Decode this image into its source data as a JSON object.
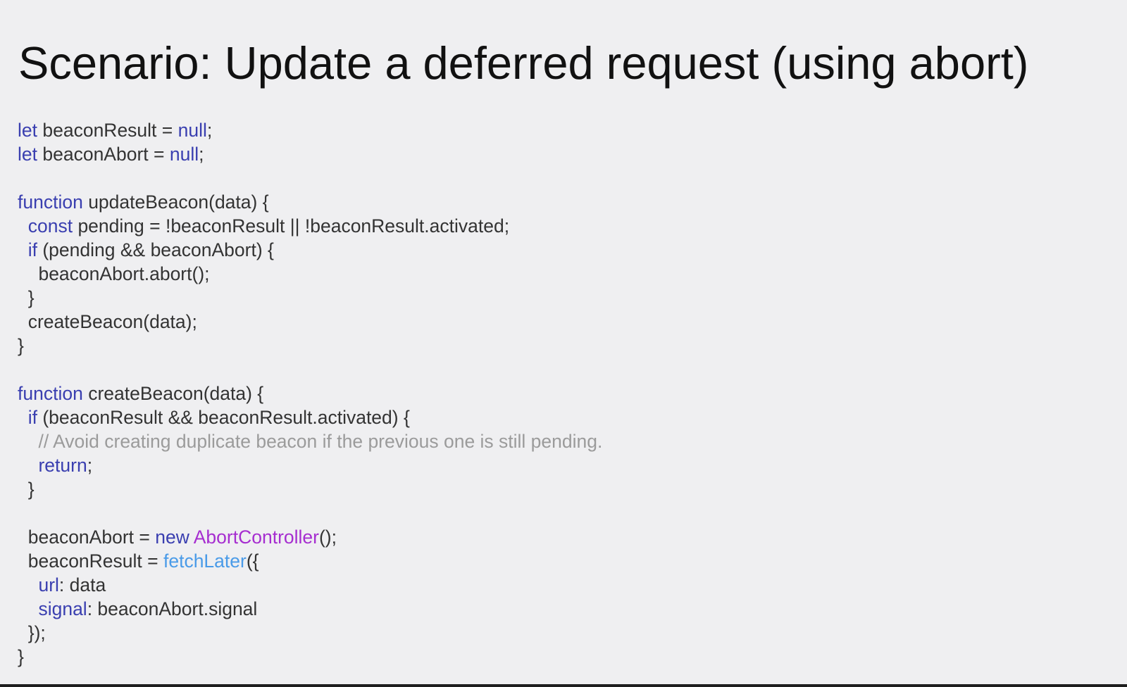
{
  "slide": {
    "title": "Scenario: Update a deferred request (using abort)"
  },
  "colors": {
    "background": "#efeff1",
    "text": "#333333",
    "keyword": "#3a3fb0",
    "class": "#a62ed0",
    "function_call": "#4a9be8",
    "comment": "#9b9b9b"
  },
  "code": {
    "lines": [
      [
        {
          "t": "let",
          "k": "keyword"
        },
        {
          "t": " beaconResult = ",
          "k": "plain"
        },
        {
          "t": "null",
          "k": "keyword"
        },
        {
          "t": ";",
          "k": "plain"
        }
      ],
      [
        {
          "t": "let",
          "k": "keyword"
        },
        {
          "t": " beaconAbort = ",
          "k": "plain"
        },
        {
          "t": "null",
          "k": "keyword"
        },
        {
          "t": ";",
          "k": "plain"
        }
      ],
      [],
      [
        {
          "t": "function",
          "k": "keyword"
        },
        {
          "t": " updateBeacon(data) {",
          "k": "plain"
        }
      ],
      [
        {
          "t": "  ",
          "k": "plain"
        },
        {
          "t": "const",
          "k": "keyword"
        },
        {
          "t": " pending = !beaconResult || !beaconResult.activated;",
          "k": "plain"
        }
      ],
      [
        {
          "t": "  ",
          "k": "plain"
        },
        {
          "t": "if",
          "k": "keyword"
        },
        {
          "t": " (pending && beaconAbort) {",
          "k": "plain"
        }
      ],
      [
        {
          "t": "    beaconAbort.abort();",
          "k": "plain"
        }
      ],
      [
        {
          "t": "  }",
          "k": "plain"
        }
      ],
      [
        {
          "t": "  createBeacon(data);",
          "k": "plain"
        }
      ],
      [
        {
          "t": "}",
          "k": "plain"
        }
      ],
      [],
      [
        {
          "t": "function",
          "k": "keyword"
        },
        {
          "t": " createBeacon(data) {",
          "k": "plain"
        }
      ],
      [
        {
          "t": "  ",
          "k": "plain"
        },
        {
          "t": "if",
          "k": "keyword"
        },
        {
          "t": " (beaconResult && beaconResult.activated) {",
          "k": "plain"
        }
      ],
      [
        {
          "t": "    // Avoid creating duplicate beacon if the previous one is still pending.",
          "k": "comment"
        }
      ],
      [
        {
          "t": "    ",
          "k": "plain"
        },
        {
          "t": "return",
          "k": "keyword"
        },
        {
          "t": ";",
          "k": "plain"
        }
      ],
      [
        {
          "t": "  }",
          "k": "plain"
        }
      ],
      [],
      [
        {
          "t": "  beaconAbort = ",
          "k": "plain"
        },
        {
          "t": "new",
          "k": "keyword"
        },
        {
          "t": " ",
          "k": "plain"
        },
        {
          "t": "AbortController",
          "k": "class"
        },
        {
          "t": "();",
          "k": "plain"
        }
      ],
      [
        {
          "t": "  beaconResult = ",
          "k": "plain"
        },
        {
          "t": "fetchLater",
          "k": "func"
        },
        {
          "t": "({",
          "k": "plain"
        }
      ],
      [
        {
          "t": "    ",
          "k": "plain"
        },
        {
          "t": "url",
          "k": "prop"
        },
        {
          "t": ": data",
          "k": "plain"
        }
      ],
      [
        {
          "t": "    ",
          "k": "plain"
        },
        {
          "t": "signal",
          "k": "prop"
        },
        {
          "t": ": beaconAbort.signal",
          "k": "plain"
        }
      ],
      [
        {
          "t": "  });",
          "k": "plain"
        }
      ],
      [
        {
          "t": "}",
          "k": "plain"
        }
      ]
    ]
  }
}
